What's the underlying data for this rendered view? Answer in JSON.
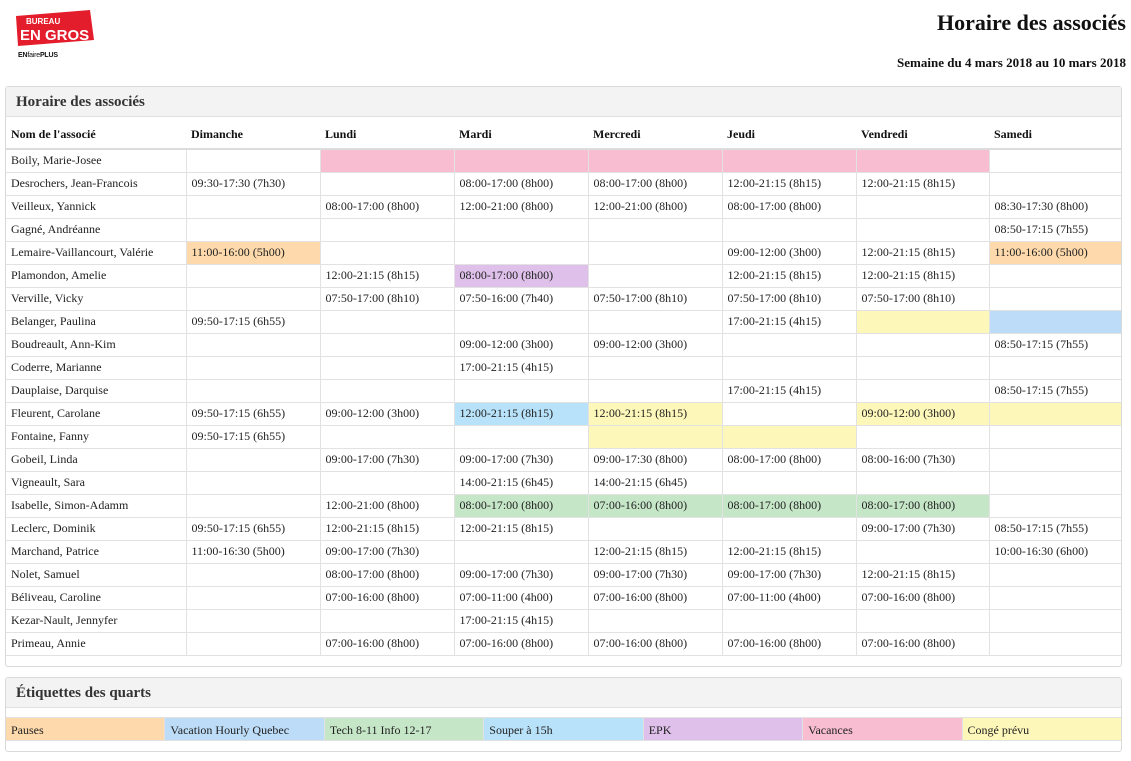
{
  "brand": {
    "logo_line1": "BUREAU",
    "logo_line2": "EN GROS",
    "tagline_en": "EN",
    "tagline_faire": "faire",
    "tagline_plus": "PLUS",
    "logo_color": "#e31d2b"
  },
  "header": {
    "title": "Horaire des associés",
    "week": "Semaine du 4 mars 2018 au 10 mars 2018"
  },
  "schedule": {
    "title": "Horaire des associés",
    "columns": [
      "Nom de l'associé",
      "Dimanche",
      "Lundi",
      "Mardi",
      "Mercredi",
      "Jeudi",
      "Vendredi",
      "Samedi"
    ],
    "rows": [
      {
        "name": "Boily, Marie-Josee",
        "cells": [
          {
            "t": "",
            "c": ""
          },
          {
            "t": "",
            "c": "vacances"
          },
          {
            "t": "",
            "c": "vacances"
          },
          {
            "t": "",
            "c": "vacances"
          },
          {
            "t": "",
            "c": "vacances"
          },
          {
            "t": "",
            "c": "vacances"
          },
          {
            "t": "",
            "c": ""
          }
        ]
      },
      {
        "name": "Desrochers, Jean-Francois",
        "cells": [
          {
            "t": "09:30-17:30 (7h30)",
            "c": ""
          },
          {
            "t": "",
            "c": ""
          },
          {
            "t": "08:00-17:00 (8h00)",
            "c": ""
          },
          {
            "t": "08:00-17:00 (8h00)",
            "c": ""
          },
          {
            "t": "12:00-21:15 (8h15)",
            "c": ""
          },
          {
            "t": "12:00-21:15 (8h15)",
            "c": ""
          },
          {
            "t": "",
            "c": ""
          }
        ]
      },
      {
        "name": "Veilleux, Yannick",
        "cells": [
          {
            "t": "",
            "c": ""
          },
          {
            "t": "08:00-17:00 (8h00)",
            "c": ""
          },
          {
            "t": "12:00-21:00 (8h00)",
            "c": ""
          },
          {
            "t": "12:00-21:00 (8h00)",
            "c": ""
          },
          {
            "t": "08:00-17:00 (8h00)",
            "c": ""
          },
          {
            "t": "",
            "c": ""
          },
          {
            "t": "08:30-17:30 (8h00)",
            "c": ""
          }
        ]
      },
      {
        "name": "Gagné, Andréanne",
        "cells": [
          {
            "t": "",
            "c": ""
          },
          {
            "t": "",
            "c": ""
          },
          {
            "t": "",
            "c": ""
          },
          {
            "t": "",
            "c": ""
          },
          {
            "t": "",
            "c": ""
          },
          {
            "t": "",
            "c": ""
          },
          {
            "t": "08:50-17:15 (7h55)",
            "c": ""
          }
        ]
      },
      {
        "name": "Lemaire-Vaillancourt, Valérie",
        "cells": [
          {
            "t": "11:00-16:00 (5h00)",
            "c": "pauses"
          },
          {
            "t": "",
            "c": ""
          },
          {
            "t": "",
            "c": ""
          },
          {
            "t": "",
            "c": ""
          },
          {
            "t": "09:00-12:00 (3h00)",
            "c": ""
          },
          {
            "t": "12:00-21:15 (8h15)",
            "c": ""
          },
          {
            "t": "11:00-16:00 (5h00)",
            "c": "pauses"
          }
        ]
      },
      {
        "name": "Plamondon, Amelie",
        "cells": [
          {
            "t": "",
            "c": ""
          },
          {
            "t": "12:00-21:15 (8h15)",
            "c": ""
          },
          {
            "t": "08:00-17:00 (8h00)",
            "c": "epk"
          },
          {
            "t": "",
            "c": ""
          },
          {
            "t": "12:00-21:15 (8h15)",
            "c": ""
          },
          {
            "t": "12:00-21:15 (8h15)",
            "c": ""
          },
          {
            "t": "",
            "c": ""
          }
        ]
      },
      {
        "name": "Verville, Vicky",
        "cells": [
          {
            "t": "",
            "c": ""
          },
          {
            "t": "07:50-17:00 (8h10)",
            "c": ""
          },
          {
            "t": "07:50-16:00 (7h40)",
            "c": ""
          },
          {
            "t": "07:50-17:00 (8h10)",
            "c": ""
          },
          {
            "t": "07:50-17:00 (8h10)",
            "c": ""
          },
          {
            "t": "07:50-17:00 (8h10)",
            "c": ""
          },
          {
            "t": "",
            "c": ""
          }
        ]
      },
      {
        "name": "Belanger, Paulina",
        "cells": [
          {
            "t": "09:50-17:15 (6h55)",
            "c": ""
          },
          {
            "t": "",
            "c": ""
          },
          {
            "t": "",
            "c": ""
          },
          {
            "t": "",
            "c": ""
          },
          {
            "t": "17:00-21:15 (4h15)",
            "c": ""
          },
          {
            "t": "",
            "c": "conge"
          },
          {
            "t": "",
            "c": "vacation"
          }
        ]
      },
      {
        "name": "Boudreault, Ann-Kim",
        "cells": [
          {
            "t": "",
            "c": ""
          },
          {
            "t": "",
            "c": ""
          },
          {
            "t": "09:00-12:00 (3h00)",
            "c": ""
          },
          {
            "t": "09:00-12:00 (3h00)",
            "c": ""
          },
          {
            "t": "",
            "c": ""
          },
          {
            "t": "",
            "c": ""
          },
          {
            "t": "08:50-17:15 (7h55)",
            "c": ""
          }
        ]
      },
      {
        "name": "Coderre, Marianne",
        "cells": [
          {
            "t": "",
            "c": ""
          },
          {
            "t": "",
            "c": ""
          },
          {
            "t": "17:00-21:15 (4h15)",
            "c": ""
          },
          {
            "t": "",
            "c": ""
          },
          {
            "t": "",
            "c": ""
          },
          {
            "t": "",
            "c": ""
          },
          {
            "t": "",
            "c": ""
          }
        ]
      },
      {
        "name": "Dauplaise, Darquise",
        "cells": [
          {
            "t": "",
            "c": ""
          },
          {
            "t": "",
            "c": ""
          },
          {
            "t": "",
            "c": ""
          },
          {
            "t": "",
            "c": ""
          },
          {
            "t": "17:00-21:15 (4h15)",
            "c": ""
          },
          {
            "t": "",
            "c": ""
          },
          {
            "t": "08:50-17:15 (7h55)",
            "c": ""
          }
        ]
      },
      {
        "name": "Fleurent, Carolane",
        "cells": [
          {
            "t": "09:50-17:15 (6h55)",
            "c": ""
          },
          {
            "t": "09:00-12:00 (3h00)",
            "c": ""
          },
          {
            "t": "12:00-21:15 (8h15)",
            "c": "souper"
          },
          {
            "t": "12:00-21:15 (8h15)",
            "c": "conge"
          },
          {
            "t": "",
            "c": ""
          },
          {
            "t": "09:00-12:00 (3h00)",
            "c": "conge"
          },
          {
            "t": "",
            "c": "conge"
          }
        ]
      },
      {
        "name": "Fontaine, Fanny",
        "cells": [
          {
            "t": "09:50-17:15 (6h55)",
            "c": ""
          },
          {
            "t": "",
            "c": ""
          },
          {
            "t": "",
            "c": ""
          },
          {
            "t": "",
            "c": "conge"
          },
          {
            "t": "",
            "c": "conge"
          },
          {
            "t": "",
            "c": ""
          },
          {
            "t": "",
            "c": ""
          }
        ]
      },
      {
        "name": "Gobeil, Linda",
        "cells": [
          {
            "t": "",
            "c": ""
          },
          {
            "t": "09:00-17:00 (7h30)",
            "c": ""
          },
          {
            "t": "09:00-17:00 (7h30)",
            "c": ""
          },
          {
            "t": "09:00-17:30 (8h00)",
            "c": ""
          },
          {
            "t": "08:00-17:00 (8h00)",
            "c": ""
          },
          {
            "t": "08:00-16:00 (7h30)",
            "c": ""
          },
          {
            "t": "",
            "c": ""
          }
        ]
      },
      {
        "name": "Vigneault, Sara",
        "cells": [
          {
            "t": "",
            "c": ""
          },
          {
            "t": "",
            "c": ""
          },
          {
            "t": "14:00-21:15 (6h45)",
            "c": ""
          },
          {
            "t": "14:00-21:15 (6h45)",
            "c": ""
          },
          {
            "t": "",
            "c": ""
          },
          {
            "t": "",
            "c": ""
          },
          {
            "t": "",
            "c": ""
          }
        ]
      },
      {
        "name": "Isabelle, Simon-Adamm",
        "cells": [
          {
            "t": "",
            "c": ""
          },
          {
            "t": "12:00-21:00 (8h00)",
            "c": ""
          },
          {
            "t": "08:00-17:00 (8h00)",
            "c": "tech"
          },
          {
            "t": "07:00-16:00 (8h00)",
            "c": "tech"
          },
          {
            "t": "08:00-17:00 (8h00)",
            "c": "tech"
          },
          {
            "t": "08:00-17:00 (8h00)",
            "c": "tech"
          },
          {
            "t": "",
            "c": ""
          }
        ]
      },
      {
        "name": "Leclerc, Dominik",
        "cells": [
          {
            "t": "09:50-17:15 (6h55)",
            "c": ""
          },
          {
            "t": "12:00-21:15 (8h15)",
            "c": ""
          },
          {
            "t": "12:00-21:15 (8h15)",
            "c": ""
          },
          {
            "t": "",
            "c": ""
          },
          {
            "t": "",
            "c": ""
          },
          {
            "t": "09:00-17:00 (7h30)",
            "c": ""
          },
          {
            "t": "08:50-17:15 (7h55)",
            "c": ""
          }
        ]
      },
      {
        "name": "Marchand, Patrice",
        "cells": [
          {
            "t": "11:00-16:30 (5h00)",
            "c": ""
          },
          {
            "t": "09:00-17:00 (7h30)",
            "c": ""
          },
          {
            "t": "",
            "c": ""
          },
          {
            "t": "12:00-21:15 (8h15)",
            "c": ""
          },
          {
            "t": "12:00-21:15 (8h15)",
            "c": ""
          },
          {
            "t": "",
            "c": ""
          },
          {
            "t": "10:00-16:30 (6h00)",
            "c": ""
          }
        ]
      },
      {
        "name": "Nolet, Samuel",
        "cells": [
          {
            "t": "",
            "c": ""
          },
          {
            "t": "08:00-17:00 (8h00)",
            "c": ""
          },
          {
            "t": "09:00-17:00 (7h30)",
            "c": ""
          },
          {
            "t": "09:00-17:00 (7h30)",
            "c": ""
          },
          {
            "t": "09:00-17:00 (7h30)",
            "c": ""
          },
          {
            "t": "12:00-21:15 (8h15)",
            "c": ""
          },
          {
            "t": "",
            "c": ""
          }
        ]
      },
      {
        "name": "Béliveau, Caroline",
        "cells": [
          {
            "t": "",
            "c": ""
          },
          {
            "t": "07:00-16:00 (8h00)",
            "c": ""
          },
          {
            "t": "07:00-11:00 (4h00)",
            "c": ""
          },
          {
            "t": "07:00-16:00 (8h00)",
            "c": ""
          },
          {
            "t": "07:00-11:00 (4h00)",
            "c": ""
          },
          {
            "t": "07:00-16:00 (8h00)",
            "c": ""
          },
          {
            "t": "",
            "c": ""
          }
        ]
      },
      {
        "name": "Kezar-Nault, Jennyfer",
        "cells": [
          {
            "t": "",
            "c": ""
          },
          {
            "t": "",
            "c": ""
          },
          {
            "t": "17:00-21:15 (4h15)",
            "c": ""
          },
          {
            "t": "",
            "c": ""
          },
          {
            "t": "",
            "c": ""
          },
          {
            "t": "",
            "c": ""
          },
          {
            "t": "",
            "c": ""
          }
        ]
      },
      {
        "name": "Primeau, Annie",
        "cells": [
          {
            "t": "",
            "c": ""
          },
          {
            "t": "07:00-16:00 (8h00)",
            "c": ""
          },
          {
            "t": "07:00-16:00 (8h00)",
            "c": ""
          },
          {
            "t": "07:00-16:00 (8h00)",
            "c": ""
          },
          {
            "t": "07:00-16:00 (8h00)",
            "c": ""
          },
          {
            "t": "07:00-16:00 (8h00)",
            "c": ""
          },
          {
            "t": "",
            "c": ""
          }
        ]
      }
    ]
  },
  "labels": {
    "title": "Étiquettes des quarts",
    "items": [
      {
        "key": "pauses",
        "label": "Pauses",
        "color": "#fdd9ab"
      },
      {
        "key": "vacation",
        "label": "Vacation Hourly Quebec",
        "color": "#bcdcf7"
      },
      {
        "key": "tech",
        "label": "Tech 8-11 Info 12-17",
        "color": "#c6e6c8"
      },
      {
        "key": "souper",
        "label": "Souper à 15h",
        "color": "#b8e2fa"
      },
      {
        "key": "epk",
        "label": "EPK",
        "color": "#dec0ea"
      },
      {
        "key": "vacances",
        "label": "Vacances",
        "color": "#f8bdd0"
      },
      {
        "key": "conge",
        "label": "Congé prévu",
        "color": "#fdf7ba"
      }
    ]
  }
}
